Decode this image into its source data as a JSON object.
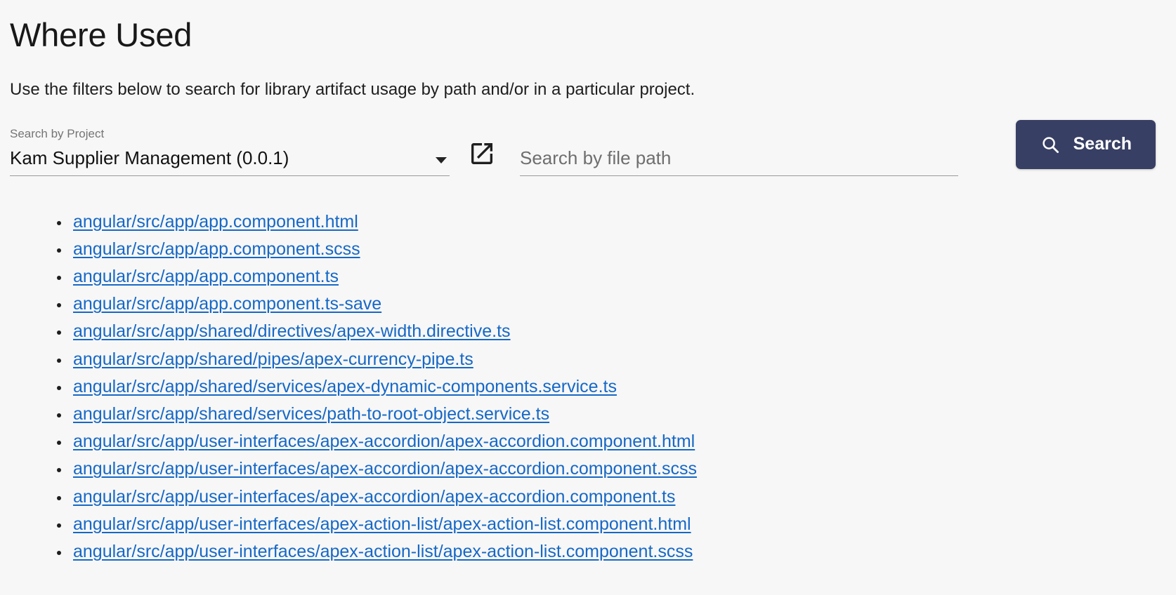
{
  "header": {
    "title": "Where Used",
    "description": "Use the filters below to search for library artifact usage by path and/or in a particular project."
  },
  "filters": {
    "project": {
      "label": "Search by Project",
      "value": "Kam Supplier Management (0.0.1)",
      "caret_icon": "chevron-down-icon",
      "open_in_new_icon": "open-in-new-icon"
    },
    "file_path": {
      "placeholder": "Search by file path",
      "value": ""
    },
    "search_button": {
      "label": "Search",
      "icon": "search-icon",
      "background_color": "#383f64",
      "text_color": "#ffffff"
    }
  },
  "results": {
    "link_color": "#1668c6",
    "items": [
      "angular/src/app/app.component.html",
      "angular/src/app/app.component.scss",
      "angular/src/app/app.component.ts",
      "angular/src/app/app.component.ts-save",
      "angular/src/app/shared/directives/apex-width.directive.ts",
      "angular/src/app/shared/pipes/apex-currency-pipe.ts",
      "angular/src/app/shared/services/apex-dynamic-components.service.ts",
      "angular/src/app/shared/services/path-to-root-object.service.ts",
      "angular/src/app/user-interfaces/apex-accordion/apex-accordion.component.html",
      "angular/src/app/user-interfaces/apex-accordion/apex-accordion.component.scss",
      "angular/src/app/user-interfaces/apex-accordion/apex-accordion.component.ts",
      "angular/src/app/user-interfaces/apex-action-list/apex-action-list.component.html",
      "angular/src/app/user-interfaces/apex-action-list/apex-action-list.component.scss"
    ]
  }
}
